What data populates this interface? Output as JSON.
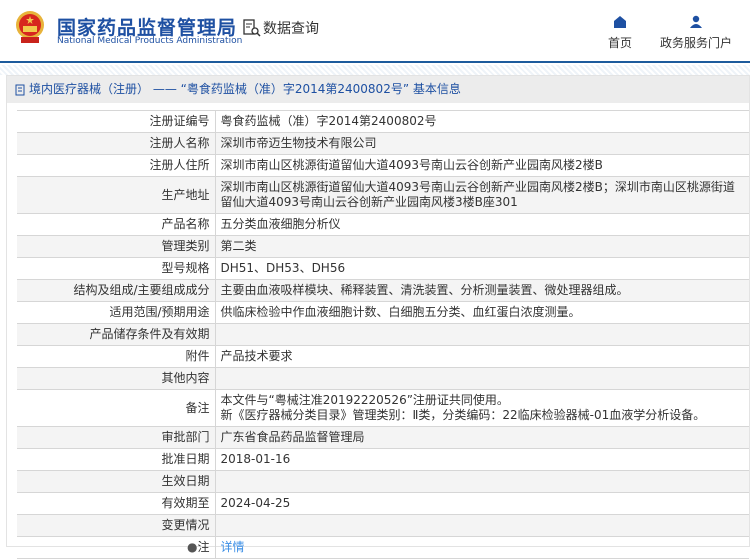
{
  "header": {
    "brand_cn": "国家药品监督管理局",
    "brand_en": "National Medical Products Administration",
    "data_query": "数据查询",
    "nav": [
      {
        "label": "首页",
        "icon": "home-icon"
      },
      {
        "label": "政务服务门户",
        "icon": "user-icon"
      }
    ]
  },
  "panel": {
    "title": "境内医疗器械（注册） —— “粤食药监械（准）字2014第2400802号” 基本信息"
  },
  "rows": [
    {
      "label": "注册证编号",
      "value": "粤食药监械（准）字2014第2400802号"
    },
    {
      "label": "注册人名称",
      "value": "深圳市帝迈生物技术有限公司"
    },
    {
      "label": "注册人住所",
      "value": "深圳市南山区桃源街道留仙大道4093号南山云谷创新产业园南风楼2楼B"
    },
    {
      "label": "生产地址",
      "value": "深圳市南山区桃源街道留仙大道4093号南山云谷创新产业园南风楼2楼B；深圳市南山区桃源街道留仙大道4093号南山云谷创新产业园南风楼3楼B座301"
    },
    {
      "label": "产品名称",
      "value": "五分类血液细胞分析仪"
    },
    {
      "label": "管理类别",
      "value": "第二类"
    },
    {
      "label": "型号规格",
      "value": "DH51、DH53、DH56"
    },
    {
      "label": "结构及组成/主要组成成分",
      "value": "主要由血液吸样模块、稀释装置、清洗装置、分析测量装置、微处理器组成。"
    },
    {
      "label": "适用范围/预期用途",
      "value": "供临床检验中作血液细胞计数、白细胞五分类、血红蛋白浓度测量。"
    },
    {
      "label": "产品储存条件及有效期",
      "value": ""
    },
    {
      "label": "附件",
      "value": "产品技术要求"
    },
    {
      "label": "其他内容",
      "value": ""
    },
    {
      "label": "备注",
      "value": "本文件与“粤械注准20192220526”注册证共同使用。",
      "value2": "新《医疗器械分类目录》管理类别：Ⅱ类，分类编码：22临床检验器械-01血液学分析设备。"
    },
    {
      "label": "审批部门",
      "value": "广东省食品药品监督管理局"
    },
    {
      "label": "批准日期",
      "value": "2018-01-16"
    },
    {
      "label": "生效日期",
      "value": ""
    },
    {
      "label": "有效期至",
      "value": "2024-04-25"
    },
    {
      "label": "变更情况",
      "value": ""
    }
  ],
  "note": {
    "label": "注",
    "link": "详情"
  }
}
